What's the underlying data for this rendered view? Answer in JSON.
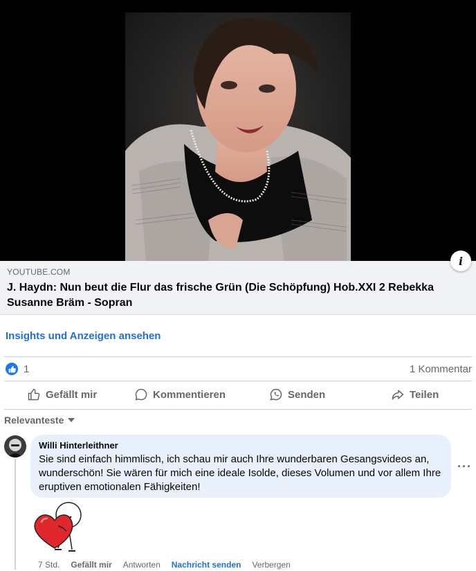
{
  "video": {
    "topline": "",
    "info_glyph": "i"
  },
  "link_preview": {
    "domain": "YOUTUBE.COM",
    "title": "J. Haydn: Nun beut die Flur das frische Grün (Die Schöpfung) Hob.XXI 2 Rebekka Susanne Bräm - Sopran"
  },
  "insights_link": "Insights und Anzeigen ansehen",
  "reactions": {
    "icon": "like-icon",
    "count": "1",
    "comment_count": "1 Kommentar"
  },
  "actions": {
    "like": "Gefällt mir",
    "comment": "Kommentieren",
    "send": "Senden",
    "share": "Teilen"
  },
  "sort_label": "Relevanteste",
  "comment": {
    "author": "Willi Hinterleithner",
    "text": "Sie sind einfach himmlisch, ich schau mir auch Ihre wunderbaren Gesangsvideos an, wunderschön! Sie wären für mich eine ideale Isolde, dieses Volumen und vor allem Ihre eruptiven emotionalen Fähigkeiten!",
    "more": "···",
    "time": "7 Std.",
    "like": "Gefällt mir",
    "reply": "Antworten",
    "message": "Nachricht senden",
    "hide": "Verbergen"
  },
  "colors": {
    "accent_blue": "#216fdb",
    "like_blue": "#1877f2",
    "bubble_bg": "#e8f1fb",
    "muted_text": "#65676b"
  }
}
